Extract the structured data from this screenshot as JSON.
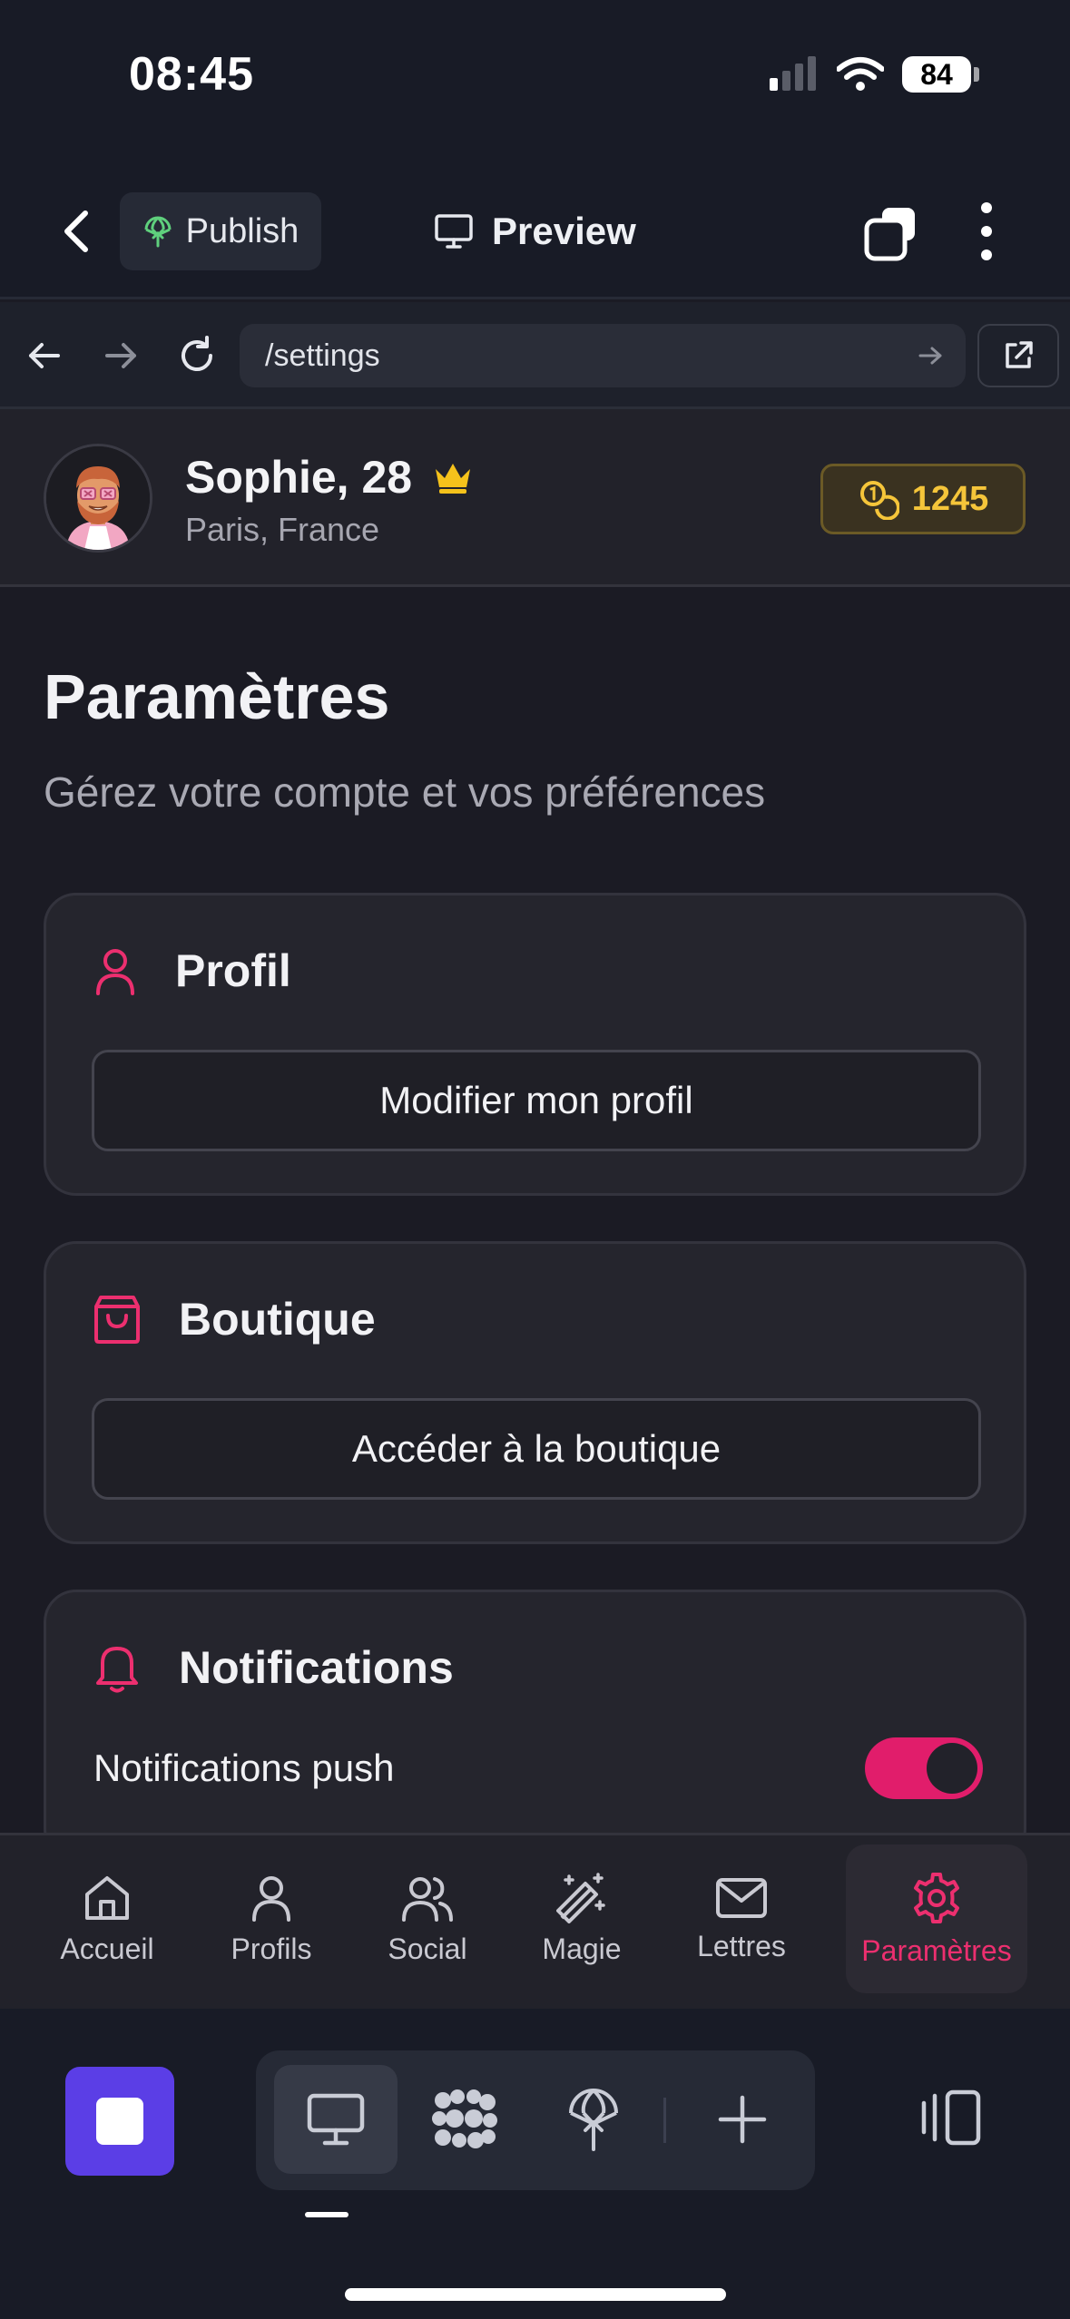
{
  "status_bar": {
    "time": "08:45",
    "battery": "84"
  },
  "toolbar": {
    "publish_label": "Publish",
    "preview_label": "Preview"
  },
  "browser": {
    "url": "/settings"
  },
  "user": {
    "name": "Sophie, 28",
    "location": "Paris, France",
    "coins": "1245",
    "premium_icon": "crown-icon"
  },
  "page": {
    "title": "Paramètres",
    "subtitle": "Gérez votre compte et vos préférences"
  },
  "sections": {
    "profile": {
      "title": "Profil",
      "button": "Modifier mon profil",
      "icon": "user-icon"
    },
    "shop": {
      "title": "Boutique",
      "button": "Accéder à la boutique",
      "icon": "shopping-bag-icon"
    },
    "notifications": {
      "title": "Notifications",
      "push_label": "Notifications push",
      "push_enabled": true,
      "icon": "bell-icon"
    }
  },
  "bottom_nav": [
    {
      "label": "Accueil",
      "icon": "home-icon",
      "active": false
    },
    {
      "label": "Profils",
      "icon": "user-icon",
      "active": false
    },
    {
      "label": "Social",
      "icon": "users-icon",
      "active": false
    },
    {
      "label": "Magie",
      "icon": "magic-wand-icon",
      "active": false
    },
    {
      "label": "Lettres",
      "icon": "mail-icon",
      "active": false
    },
    {
      "label": "Paramètres",
      "icon": "gear-icon",
      "active": true
    }
  ],
  "colors": {
    "accent": "#ec2f6f",
    "toggle_on": "#e11d6b",
    "coins": "#f5c53a",
    "builder_stop": "#5b3ee6",
    "background": "#1b1b24",
    "card": "#25252d"
  }
}
